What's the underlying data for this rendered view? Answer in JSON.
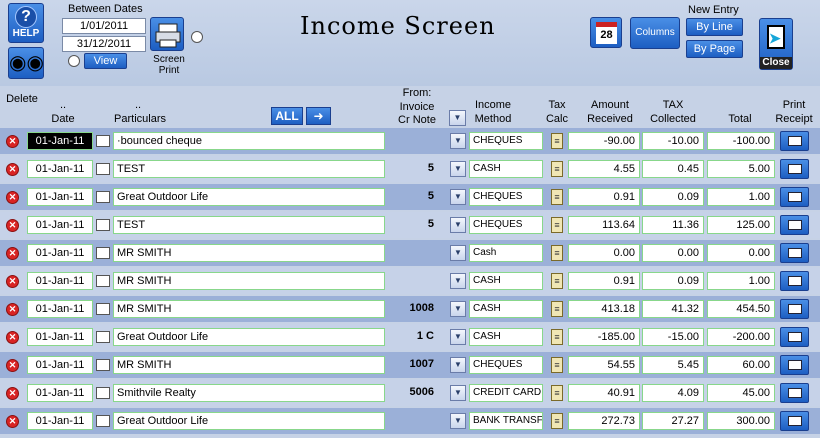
{
  "header": {
    "help_label": "HELP",
    "between_dates_label": "Between Dates",
    "date_from": "1/01/2011",
    "date_to": "31/12/2011",
    "view_label": "View",
    "screen_print_label": "Screen Print",
    "title": "Income Screen",
    "calendar_day": "28",
    "columns_label": "Columns",
    "new_entry_label": "New Entry",
    "by_line_label": "By Line",
    "by_page_label": "By Page",
    "close_label": "Close"
  },
  "columns": {
    "delete": "Delete",
    "date_dots": "..",
    "date": "Date",
    "particulars_dots": "..",
    "particulars": "Particulars",
    "all_label": "ALL",
    "from": "From:",
    "invoice_line1": "Invoice",
    "invoice_line2": "Cr Note",
    "income_line1": "Income",
    "income_line2": "Method",
    "taxcalc_line1": "Tax",
    "taxcalc_line2": "Calc",
    "amount_line1": "Amount",
    "amount_line2": "Received",
    "tax_line1": "TAX",
    "tax_line2": "Collected",
    "total": "Total",
    "print_line1": "Print",
    "print_line2": "Receipt"
  },
  "rows": [
    {
      "date": "01-Jan-11",
      "particulars": "·bounced cheque",
      "invoice": "",
      "method": "CHEQUES",
      "amount": "-90.00",
      "tax": "-10.00",
      "total": "-100.00"
    },
    {
      "date": "01-Jan-11",
      "particulars": "TEST",
      "invoice": "5",
      "method": "CASH",
      "amount": "4.55",
      "tax": "0.45",
      "total": "5.00"
    },
    {
      "date": "01-Jan-11",
      "particulars": "Great Outdoor Life",
      "invoice": "5",
      "method": "CHEQUES",
      "amount": "0.91",
      "tax": "0.09",
      "total": "1.00"
    },
    {
      "date": "01-Jan-11",
      "particulars": "TEST",
      "invoice": "5",
      "method": "CHEQUES",
      "amount": "113.64",
      "tax": "11.36",
      "total": "125.00"
    },
    {
      "date": "01-Jan-11",
      "particulars": "MR SMITH",
      "invoice": "",
      "method": "Cash",
      "amount": "0.00",
      "tax": "0.00",
      "total": "0.00"
    },
    {
      "date": "01-Jan-11",
      "particulars": "MR SMITH",
      "invoice": "",
      "method": "CASH",
      "amount": "0.91",
      "tax": "0.09",
      "total": "1.00"
    },
    {
      "date": "01-Jan-11",
      "particulars": "MR SMITH",
      "invoice": "1008",
      "method": "CASH",
      "amount": "413.18",
      "tax": "41.32",
      "total": "454.50"
    },
    {
      "date": "01-Jan-11",
      "particulars": "Great Outdoor Life",
      "invoice": "1 C",
      "method": "CASH",
      "amount": "-185.00",
      "tax": "-15.00",
      "total": "-200.00"
    },
    {
      "date": "01-Jan-11",
      "particulars": "MR SMITH",
      "invoice": "1007",
      "method": "CHEQUES",
      "amount": "54.55",
      "tax": "5.45",
      "total": "60.00"
    },
    {
      "date": "01-Jan-11",
      "particulars": "Smithvile Realty",
      "invoice": "5006",
      "method": "CREDIT CARD",
      "amount": "40.91",
      "tax": "4.09",
      "total": "45.00"
    },
    {
      "date": "01-Jan-11",
      "particulars": "Great Outdoor Life",
      "invoice": "",
      "method": "BANK TRANSFER",
      "amount": "272.73",
      "tax": "27.27",
      "total": "300.00"
    }
  ],
  "colors": {
    "accent": "#1d5ec2",
    "row_light": "#c6d2e8",
    "row_dark": "#9bb0d8",
    "field_border": "#88d78b",
    "delete": "#d92424"
  }
}
